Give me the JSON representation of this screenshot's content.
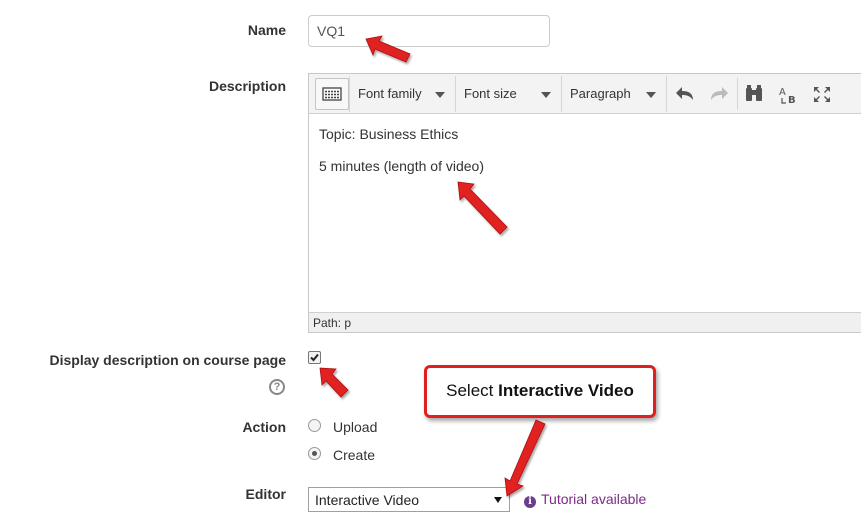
{
  "form": {
    "name_label": "Name",
    "name_value": "VQ1",
    "description_label": "Description",
    "display_description_label": "Display description on course page",
    "display_description_checked": true,
    "help_glyph": "?",
    "action_label": "Action",
    "action_options": [
      {
        "label": "Upload",
        "selected": false
      },
      {
        "label": "Create",
        "selected": true
      }
    ],
    "editor_label": "Editor",
    "editor_value": "Interactive Video",
    "tutorial_glyph": "i",
    "tutorial_text": "Tutorial available"
  },
  "editor": {
    "toolbar": {
      "font_family": "Font family",
      "font_size": "Font size",
      "format": "Paragraph",
      "icons": [
        "toggle-toolbar-icon",
        "undo-icon",
        "redo-icon",
        "find-icon",
        "spellcheck-icon",
        "fullscreen-icon"
      ]
    },
    "content": [
      "Topic: Business Ethics",
      "5 minutes (length of video)"
    ],
    "path_text": "Path: p"
  },
  "annotation": {
    "callout_prefix": "Select ",
    "callout_bold": "Interactive Video",
    "color": "#e02020"
  }
}
